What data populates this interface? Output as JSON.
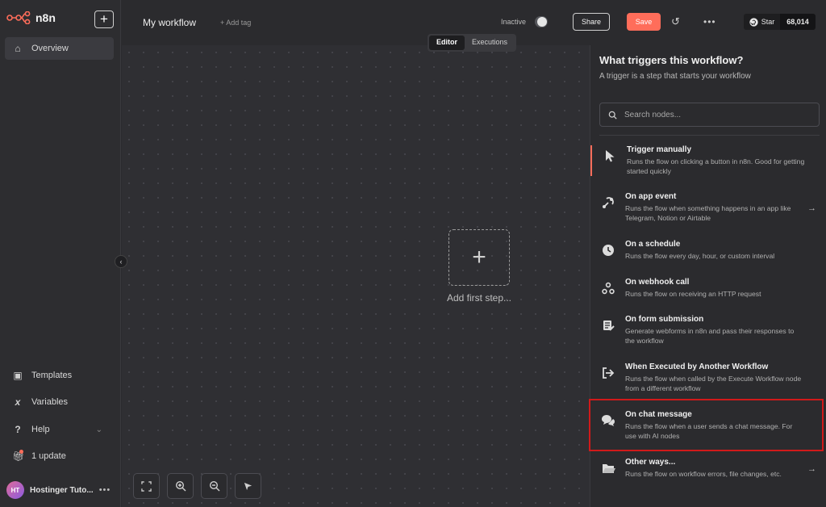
{
  "brand": {
    "logo_text": "n8n",
    "accent": "#ff6d5a"
  },
  "sidebar": {
    "new_button": "+",
    "overview": "Overview",
    "templates": "Templates",
    "variables": "Variables",
    "help": "Help",
    "updates": "1 update",
    "user_initials": "HT",
    "user_name": "Hostinger Tuto..."
  },
  "header": {
    "workflow_title": "My workflow",
    "add_tag": "+ Add tag",
    "status": "Inactive",
    "share": "Share",
    "save": "Save",
    "github_star": "Star",
    "github_count": "68,014"
  },
  "tabs": {
    "editor": "Editor",
    "executions": "Executions"
  },
  "canvas": {
    "add_first_step": "Add first step..."
  },
  "panel": {
    "title": "What triggers this workflow?",
    "subtitle": "A trigger is a step that starts your workflow",
    "search_placeholder": "Search nodes...",
    "triggers": [
      {
        "title": "Trigger manually",
        "desc": "Runs the flow on clicking a button in n8n. Good for getting started quickly",
        "icon": "cursor-icon"
      },
      {
        "title": "On app event",
        "desc": "Runs the flow when something happens in an app like Telegram, Notion or Airtable",
        "icon": "app-event-icon"
      },
      {
        "title": "On a schedule",
        "desc": "Runs the flow every day, hour, or custom interval",
        "icon": "clock-icon"
      },
      {
        "title": "On webhook call",
        "desc": "Runs the flow on receiving an HTTP request",
        "icon": "webhook-icon"
      },
      {
        "title": "On form submission",
        "desc": "Generate webforms in n8n and pass their responses to the workflow",
        "icon": "form-icon"
      },
      {
        "title": "When Executed by Another Workflow",
        "desc": "Runs the flow when called by the Execute Workflow node from a different workflow",
        "icon": "sign-in-icon"
      },
      {
        "title": "On chat message",
        "desc": "Runs the flow when a user sends a chat message. For use with AI nodes",
        "icon": "chat-icon"
      },
      {
        "title": "Other ways...",
        "desc": "Runs the flow on workflow errors, file changes, etc.",
        "icon": "folder-icon"
      }
    ]
  }
}
